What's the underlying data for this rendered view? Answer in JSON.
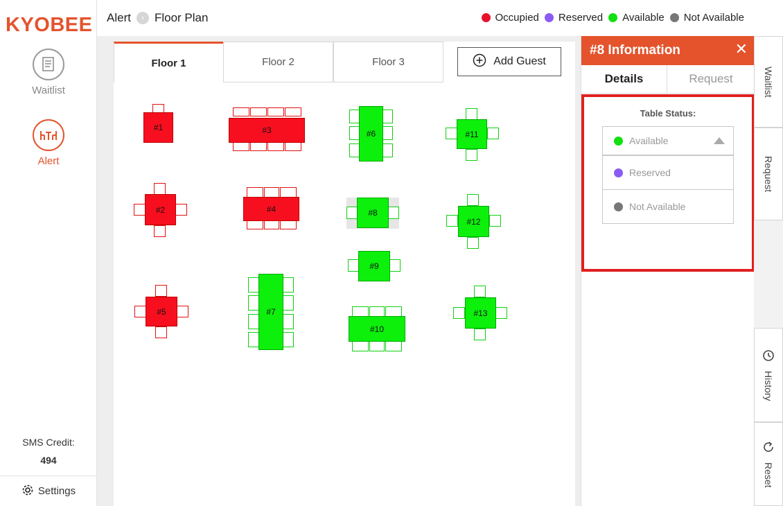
{
  "app": {
    "logo": "KYOBEE"
  },
  "sidebar": {
    "items": [
      {
        "label": "Waitlist",
        "icon": "waitlist-icon"
      },
      {
        "label": "Alert",
        "icon": "alert-table-icon"
      }
    ],
    "sms_label": "SMS Credit:",
    "sms_value": "494",
    "settings_label": "Settings"
  },
  "header": {
    "crumb1": "Alert",
    "crumb2": "Floor Plan"
  },
  "legend": [
    {
      "label": "Occupied",
      "color": "#e8112d"
    },
    {
      "label": "Reserved",
      "color": "#8a5cf5"
    },
    {
      "label": "Available",
      "color": "#11e011"
    },
    {
      "label": "Not Available",
      "color": "#777777"
    }
  ],
  "floors": [
    "Floor 1",
    "Floor 2",
    "Floor 3"
  ],
  "add_guest_label": "Add Guest",
  "tables": [
    "#1",
    "#2",
    "#3",
    "#4",
    "#5",
    "#6",
    "#7",
    "#8",
    "#9",
    "#10",
    "#11",
    "#12",
    "#13"
  ],
  "info_panel": {
    "title": "#8 Information",
    "tabs": [
      "Details",
      "Request"
    ],
    "status_label": "Table Status:",
    "options": [
      {
        "label": "Available",
        "color": "#11e011"
      },
      {
        "label": "Reserved",
        "color": "#8a5cf5"
      },
      {
        "label": "Not Available",
        "color": "#777777"
      }
    ]
  },
  "vtabs": [
    "Waitlist",
    "Request",
    "History",
    "Reset"
  ]
}
